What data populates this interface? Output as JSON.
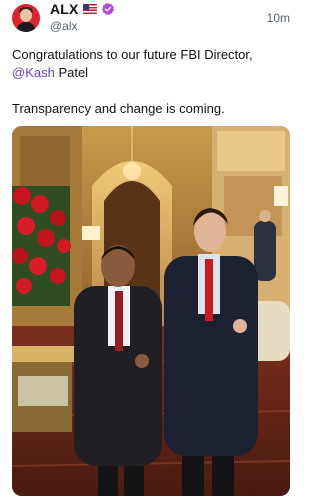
{
  "author": {
    "name": "ALX",
    "handle": "@alx",
    "flag_icon": "us-flag-icon",
    "verified_icon": "verified-badge-icon",
    "verified_color": "#b44ad8"
  },
  "post": {
    "time": "10m",
    "line1": "Congratulations to our future FBI Director,",
    "mention": "@Kash",
    "mention_suffix": " Patel",
    "line3": "Transparency and change is coming.",
    "mention_color": "#6a3fd6"
  },
  "media": {
    "type": "photo",
    "subject": "two men in suits posing in an ornate gilded room with red roses"
  }
}
